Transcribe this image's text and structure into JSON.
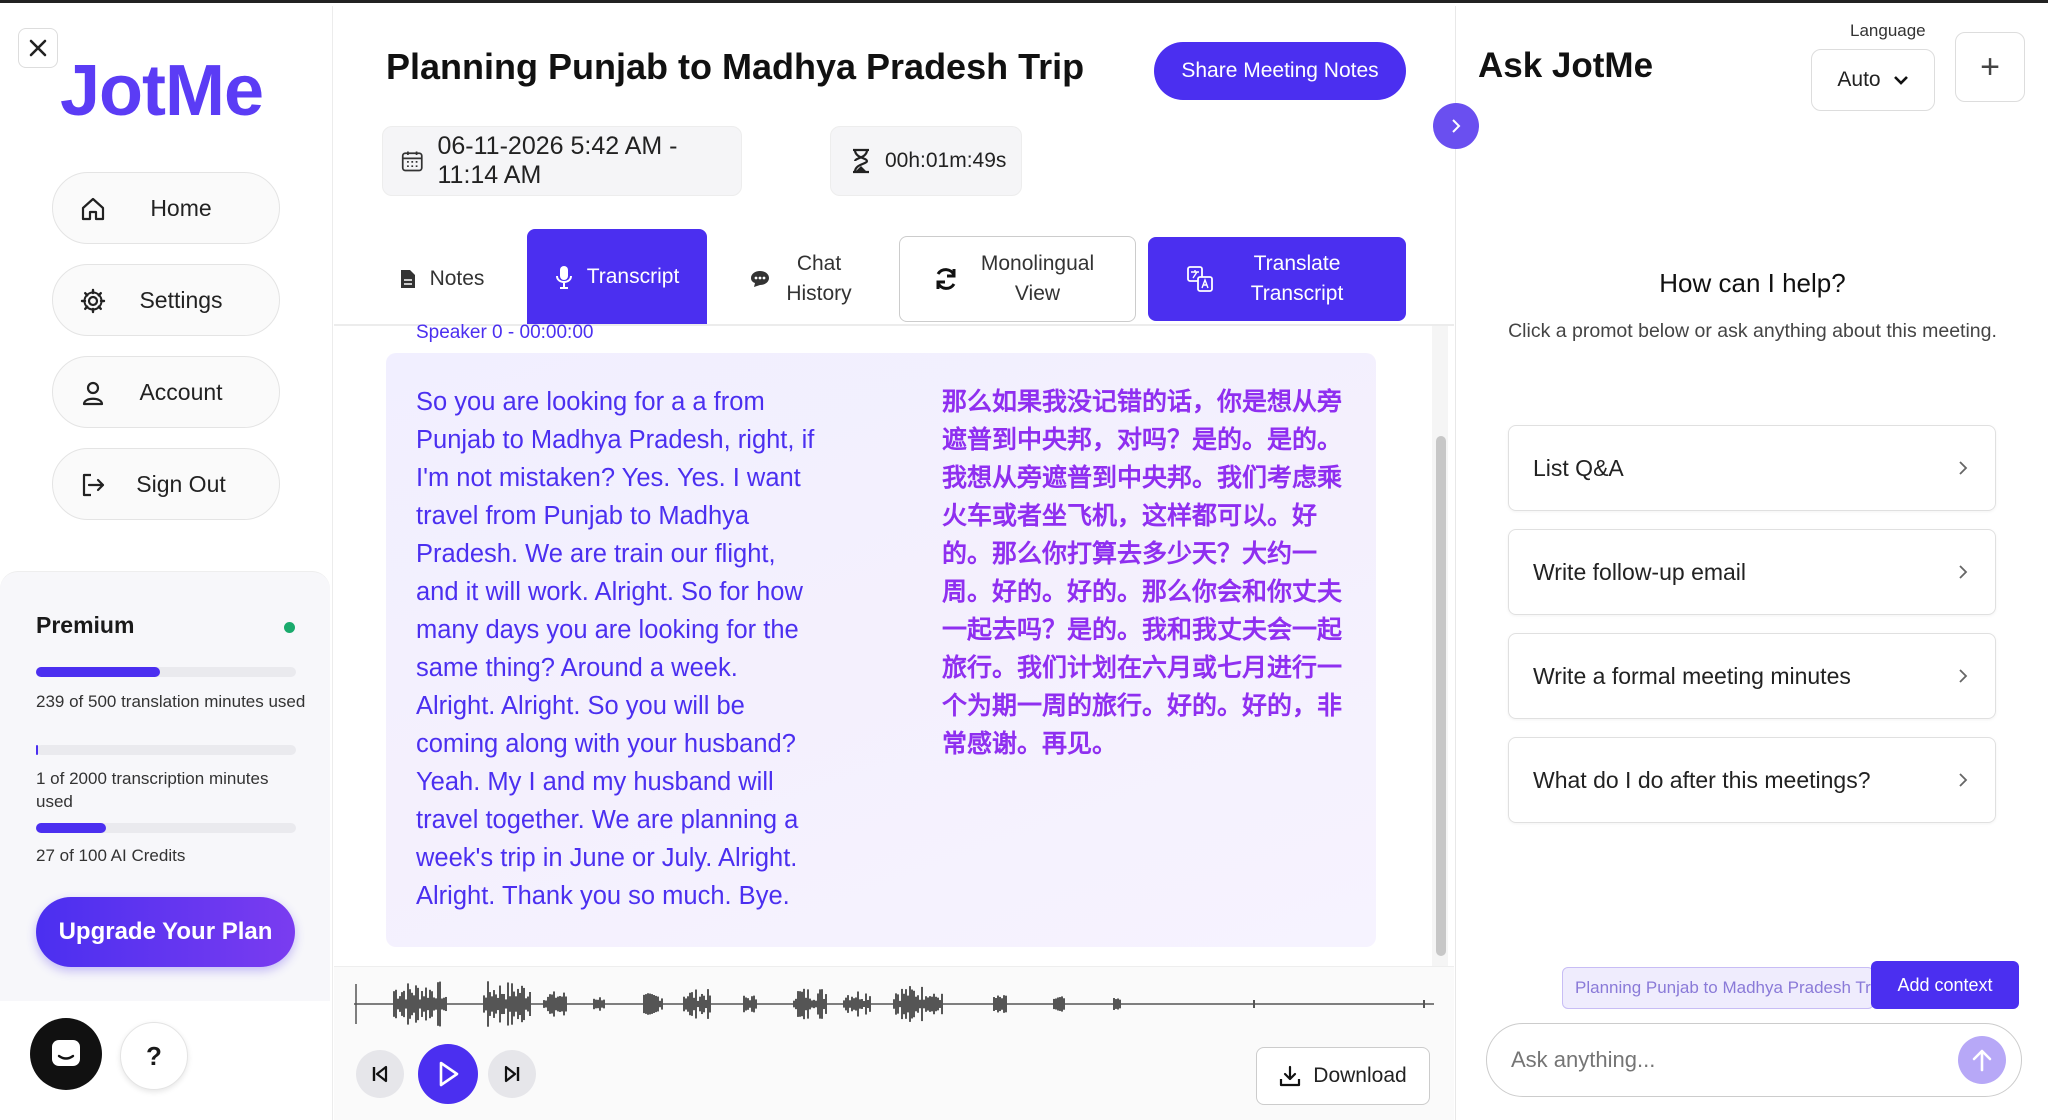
{
  "sidebar": {
    "close_label": "×",
    "logo": "JotMe",
    "nav": {
      "home": "Home",
      "settings": "Settings",
      "account": "Account",
      "signout": "Sign Out"
    },
    "premium": {
      "title": "Premium",
      "translation_usage": "239 of 500 translation minutes used",
      "translation_progress": 0.478,
      "transcription_usage": "1 of 2000 transcription minutes used",
      "transcription_progress": 0.0005,
      "ai_credits": "27 of 100 AI Credits",
      "ai_progress": 0.27,
      "upgrade_label": "Upgrade Your Plan"
    },
    "help_label": "?"
  },
  "meeting": {
    "title": "Planning Punjab to Madhya Pradesh Trip",
    "share_label": "Share Meeting Notes",
    "datetime": "06-11-2026 5:42 AM - 11:14 AM",
    "duration": "00h:01m:49s"
  },
  "tabs": {
    "notes": "Notes",
    "transcript": "Transcript",
    "chat_history": "Chat History",
    "monolingual": "Monolingual View",
    "translate": "Translate Transcript"
  },
  "transcript": {
    "speaker": "Speaker 0 - 00:00:00",
    "english": "So you are looking for a a from Punjab to Madhya Pradesh, right, if I'm not mistaken? Yes. Yes. I want travel from Punjab to Madhya Pradesh. We are train our flight, and it will work. Alright. So for how many days you are looking for the same thing? Around a week. Alright. Alright. So you will be coming along with your husband? Yeah. My I and my husband will travel together. We are planning a week's trip in June or July. Alright. Alright. Thank you so much. Bye.",
    "chinese": "那么如果我没记错的话，你是想从旁遮普到中央邦，对吗？是的。是的。我想从旁遮普到中央邦。我们考虑乘火车或者坐飞机，这样都可以。好的。那么你打算去多少天？大约一周。好的。好的。那么你会和你丈夫一起去吗？是的。我和我丈夫会一起旅行。我们计划在六月或七月进行一个为期一周的旅行。好的。好的，非常感谢。再见。"
  },
  "player": {
    "download_label": "Download"
  },
  "ask": {
    "title": "Ask JotMe",
    "language_label": "Language",
    "language_value": "Auto",
    "plus_label": "+",
    "help_title": "How can I help?",
    "help_sub": "Click a promot below or ask anything about this meeting.",
    "prompts": [
      "List Q&A",
      "Write follow-up email",
      "Write a formal meeting minutes",
      "What do I do after this meetings?"
    ],
    "context_chip": "Planning Punjab to Madhya Pradesh Trip",
    "add_context_label": "Add context",
    "input_placeholder": "Ask anything..."
  },
  "colors": {
    "accent": "#4b2ff0",
    "translation_text": "#8f2ff0",
    "status_green": "#1aaa6c"
  }
}
